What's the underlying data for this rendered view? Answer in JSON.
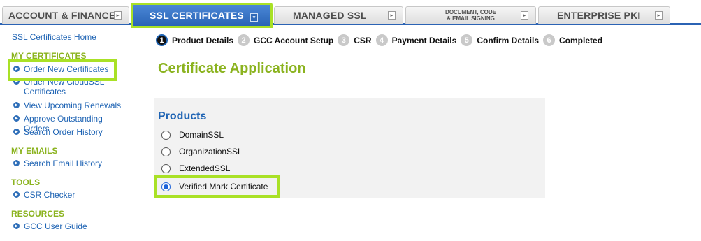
{
  "nav": {
    "tabs": [
      {
        "label": "ACCOUNT & FINANCE"
      },
      {
        "label": "SSL CERTIFICATES"
      },
      {
        "label": "MANAGED SSL"
      },
      {
        "label_line1": "DOCUMENT, CODE",
        "label_line2": "& EMAIL SIGNING"
      },
      {
        "label": "ENTERPRISE PKI"
      }
    ],
    "active_tab": "SSL CERTIFICATES"
  },
  "sidebar": {
    "home": "SSL Certificates Home",
    "sections": [
      {
        "title": "MY CERTIFICATES",
        "items": [
          "Order New Certificates",
          "Order New CloudSSL Certificates",
          "View Upcoming Renewals",
          "Approve Outstanding Orders",
          "Search Order History"
        ]
      },
      {
        "title": "MY EMAILS",
        "items": [
          "Search Email History"
        ]
      },
      {
        "title": "TOOLS",
        "items": [
          "CSR Checker"
        ]
      },
      {
        "title": "RESOURCES",
        "items": [
          "GCC User Guide"
        ]
      }
    ]
  },
  "steps": [
    {
      "num": "1",
      "label": "Product Details"
    },
    {
      "num": "2",
      "label": "GCC Account Setup"
    },
    {
      "num": "3",
      "label": "CSR"
    },
    {
      "num": "4",
      "label": "Payment Details"
    },
    {
      "num": "5",
      "label": "Confirm Details"
    },
    {
      "num": "6",
      "label": "Completed"
    }
  ],
  "current_step": "Product Details",
  "main": {
    "title": "Certificate Application",
    "products_heading": "Products",
    "options": [
      "DomainSSL",
      "OrganizationSSL",
      "ExtendedSSL",
      "Verified Mark Certificate"
    ],
    "selected_option": "Verified Mark Certificate"
  },
  "colors": {
    "accent_green": "#8bb31f",
    "highlight": "#a9e126",
    "link_blue": "#1f64b4",
    "nav_blue": "#2b63b4"
  },
  "icons": {
    "tab_arrow": "tab-arrow-icon",
    "bullet": "circle-arrow-icon"
  }
}
